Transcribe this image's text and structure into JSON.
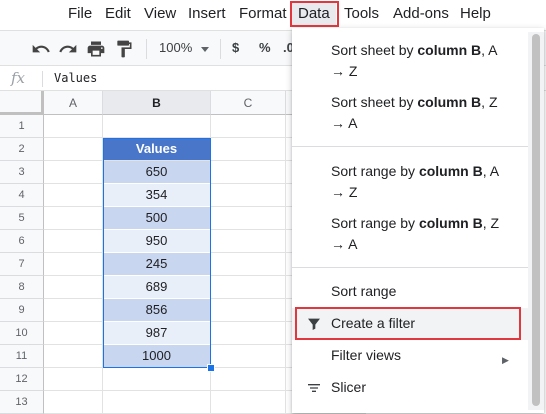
{
  "menubar": {
    "file": "File",
    "edit": "Edit",
    "view": "View",
    "insert": "Insert",
    "format": "Format",
    "data": "Data",
    "tools": "Tools",
    "addons": "Add-ons",
    "help": "Help"
  },
  "toolbar": {
    "zoom": "100%",
    "currency": "$",
    "percent": "%",
    "decimal": ".0"
  },
  "formula_bar": {
    "fx": "fx",
    "value": "Values"
  },
  "grid": {
    "columns": [
      "A",
      "B",
      "C"
    ],
    "rows": [
      "1",
      "2",
      "3",
      "4",
      "5",
      "6",
      "7",
      "8",
      "9",
      "10",
      "11",
      "12",
      "13"
    ],
    "header": "Values",
    "values": [
      "650",
      "354",
      "500",
      "950",
      "245",
      "689",
      "856",
      "987",
      "1000"
    ]
  },
  "menu": {
    "sort_sheet_az": {
      "pre": "Sort sheet by ",
      "bold": "column B",
      "post": ", A",
      "line2": "→ Z"
    },
    "sort_sheet_za": {
      "pre": "Sort sheet by ",
      "bold": "column B",
      "post": ", Z",
      "line2": "→ A"
    },
    "sort_range_az": {
      "pre": "Sort range by ",
      "bold": "column B",
      "post": ", A",
      "line2": "→ Z"
    },
    "sort_range_za": {
      "pre": "Sort range by ",
      "bold": "column B",
      "post": ", Z",
      "line2": "→ A"
    },
    "sort_range": "Sort range",
    "create_filter": "Create a filter",
    "filter_views": "Filter views",
    "slicer": "Slicer"
  },
  "colors": {
    "header_fill": "#4a76c9",
    "band_dark": "#c9d6ef",
    "band_light": "#e8eff9",
    "highlight": "#e0383e"
  }
}
